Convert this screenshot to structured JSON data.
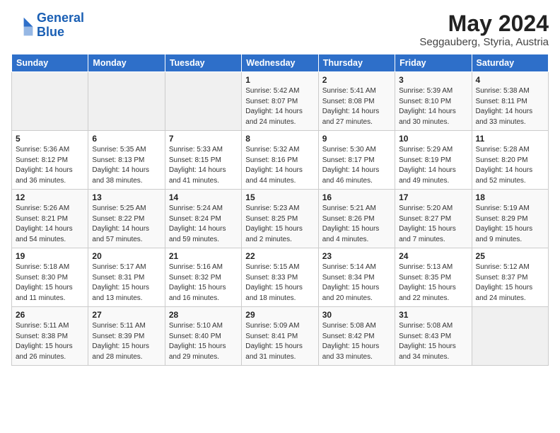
{
  "logo": {
    "line1": "General",
    "line2": "Blue"
  },
  "title": "May 2024",
  "subtitle": "Seggauberg, Styria, Austria",
  "weekdays": [
    "Sunday",
    "Monday",
    "Tuesday",
    "Wednesday",
    "Thursday",
    "Friday",
    "Saturday"
  ],
  "weeks": [
    [
      {
        "day": "",
        "info": ""
      },
      {
        "day": "",
        "info": ""
      },
      {
        "day": "",
        "info": ""
      },
      {
        "day": "1",
        "info": "Sunrise: 5:42 AM\nSunset: 8:07 PM\nDaylight: 14 hours\nand 24 minutes."
      },
      {
        "day": "2",
        "info": "Sunrise: 5:41 AM\nSunset: 8:08 PM\nDaylight: 14 hours\nand 27 minutes."
      },
      {
        "day": "3",
        "info": "Sunrise: 5:39 AM\nSunset: 8:10 PM\nDaylight: 14 hours\nand 30 minutes."
      },
      {
        "day": "4",
        "info": "Sunrise: 5:38 AM\nSunset: 8:11 PM\nDaylight: 14 hours\nand 33 minutes."
      }
    ],
    [
      {
        "day": "5",
        "info": "Sunrise: 5:36 AM\nSunset: 8:12 PM\nDaylight: 14 hours\nand 36 minutes."
      },
      {
        "day": "6",
        "info": "Sunrise: 5:35 AM\nSunset: 8:13 PM\nDaylight: 14 hours\nand 38 minutes."
      },
      {
        "day": "7",
        "info": "Sunrise: 5:33 AM\nSunset: 8:15 PM\nDaylight: 14 hours\nand 41 minutes."
      },
      {
        "day": "8",
        "info": "Sunrise: 5:32 AM\nSunset: 8:16 PM\nDaylight: 14 hours\nand 44 minutes."
      },
      {
        "day": "9",
        "info": "Sunrise: 5:30 AM\nSunset: 8:17 PM\nDaylight: 14 hours\nand 46 minutes."
      },
      {
        "day": "10",
        "info": "Sunrise: 5:29 AM\nSunset: 8:19 PM\nDaylight: 14 hours\nand 49 minutes."
      },
      {
        "day": "11",
        "info": "Sunrise: 5:28 AM\nSunset: 8:20 PM\nDaylight: 14 hours\nand 52 minutes."
      }
    ],
    [
      {
        "day": "12",
        "info": "Sunrise: 5:26 AM\nSunset: 8:21 PM\nDaylight: 14 hours\nand 54 minutes."
      },
      {
        "day": "13",
        "info": "Sunrise: 5:25 AM\nSunset: 8:22 PM\nDaylight: 14 hours\nand 57 minutes."
      },
      {
        "day": "14",
        "info": "Sunrise: 5:24 AM\nSunset: 8:24 PM\nDaylight: 14 hours\nand 59 minutes."
      },
      {
        "day": "15",
        "info": "Sunrise: 5:23 AM\nSunset: 8:25 PM\nDaylight: 15 hours\nand 2 minutes."
      },
      {
        "day": "16",
        "info": "Sunrise: 5:21 AM\nSunset: 8:26 PM\nDaylight: 15 hours\nand 4 minutes."
      },
      {
        "day": "17",
        "info": "Sunrise: 5:20 AM\nSunset: 8:27 PM\nDaylight: 15 hours\nand 7 minutes."
      },
      {
        "day": "18",
        "info": "Sunrise: 5:19 AM\nSunset: 8:29 PM\nDaylight: 15 hours\nand 9 minutes."
      }
    ],
    [
      {
        "day": "19",
        "info": "Sunrise: 5:18 AM\nSunset: 8:30 PM\nDaylight: 15 hours\nand 11 minutes."
      },
      {
        "day": "20",
        "info": "Sunrise: 5:17 AM\nSunset: 8:31 PM\nDaylight: 15 hours\nand 13 minutes."
      },
      {
        "day": "21",
        "info": "Sunrise: 5:16 AM\nSunset: 8:32 PM\nDaylight: 15 hours\nand 16 minutes."
      },
      {
        "day": "22",
        "info": "Sunrise: 5:15 AM\nSunset: 8:33 PM\nDaylight: 15 hours\nand 18 minutes."
      },
      {
        "day": "23",
        "info": "Sunrise: 5:14 AM\nSunset: 8:34 PM\nDaylight: 15 hours\nand 20 minutes."
      },
      {
        "day": "24",
        "info": "Sunrise: 5:13 AM\nSunset: 8:35 PM\nDaylight: 15 hours\nand 22 minutes."
      },
      {
        "day": "25",
        "info": "Sunrise: 5:12 AM\nSunset: 8:37 PM\nDaylight: 15 hours\nand 24 minutes."
      }
    ],
    [
      {
        "day": "26",
        "info": "Sunrise: 5:11 AM\nSunset: 8:38 PM\nDaylight: 15 hours\nand 26 minutes."
      },
      {
        "day": "27",
        "info": "Sunrise: 5:11 AM\nSunset: 8:39 PM\nDaylight: 15 hours\nand 28 minutes."
      },
      {
        "day": "28",
        "info": "Sunrise: 5:10 AM\nSunset: 8:40 PM\nDaylight: 15 hours\nand 29 minutes."
      },
      {
        "day": "29",
        "info": "Sunrise: 5:09 AM\nSunset: 8:41 PM\nDaylight: 15 hours\nand 31 minutes."
      },
      {
        "day": "30",
        "info": "Sunrise: 5:08 AM\nSunset: 8:42 PM\nDaylight: 15 hours\nand 33 minutes."
      },
      {
        "day": "31",
        "info": "Sunrise: 5:08 AM\nSunset: 8:43 PM\nDaylight: 15 hours\nand 34 minutes."
      },
      {
        "day": "",
        "info": ""
      }
    ]
  ]
}
